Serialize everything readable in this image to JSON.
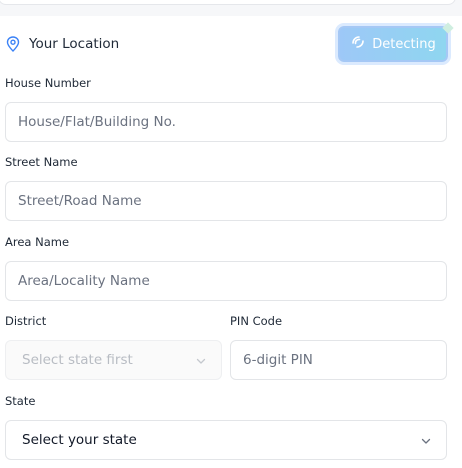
{
  "location": {
    "title": "Your Location",
    "detect_button": "Detecting"
  },
  "fields": {
    "house": {
      "label": "House Number",
      "placeholder": "House/Flat/Building No."
    },
    "street": {
      "label": "Street Name",
      "placeholder": "Street/Road Name"
    },
    "area": {
      "label": "Area Name",
      "placeholder": "Area/Locality Name"
    },
    "district": {
      "label": "District",
      "placeholder": "Select state first"
    },
    "pin": {
      "label": "PIN Code",
      "placeholder": "6-digit PIN"
    },
    "state": {
      "label": "State",
      "placeholder": "Select your state"
    }
  },
  "icons": [
    "map-pin-icon",
    "signal-icon",
    "chevron-down-icon"
  ],
  "colors": {
    "accent": "#9dc8f7",
    "pin": "#3b82f6"
  }
}
